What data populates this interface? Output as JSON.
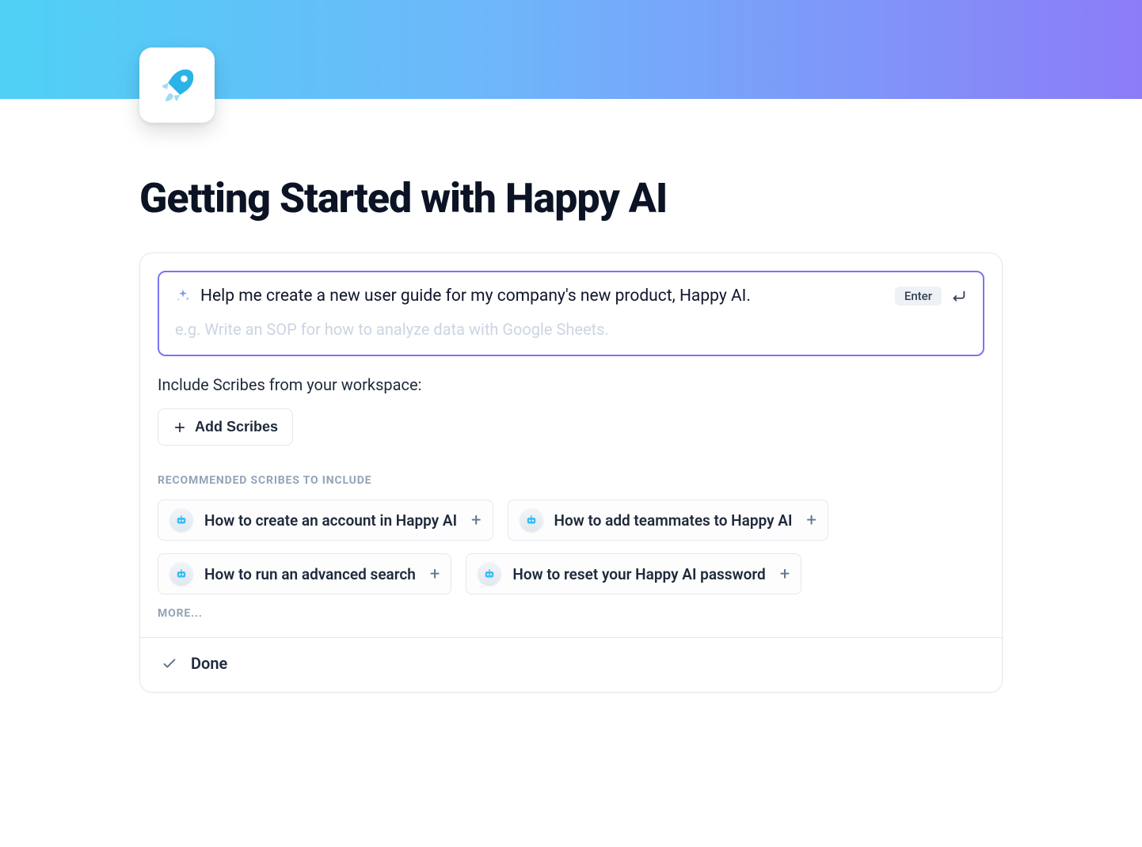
{
  "page": {
    "title": "Getting Started with Happy AI"
  },
  "prompt": {
    "text": "Help me create a new user guide for my company's new product, Happy AI.",
    "placeholder": "e.g. Write an SOP for how to analyze data with Google Sheets.",
    "enter_label": "Enter"
  },
  "include": {
    "label": "Include Scribes from your workspace:",
    "add_button": "Add Scribes"
  },
  "recommended": {
    "heading": "RECOMMENDED SCRIBES TO INCLUDE",
    "items": [
      {
        "label": "How to create an account in Happy AI"
      },
      {
        "label": "How to add teammates to Happy AI"
      },
      {
        "label": "How to run an advanced search"
      },
      {
        "label": "How to reset your Happy AI password"
      }
    ],
    "more_label": "MORE..."
  },
  "done": {
    "label": "Done"
  }
}
